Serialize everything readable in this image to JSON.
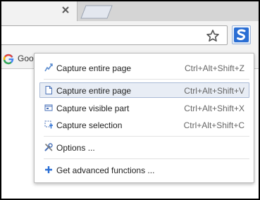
{
  "bookmarks": {
    "item_label": "Goo"
  },
  "menu": {
    "items": [
      {
        "label": "Capture entire page",
        "shortcut": "Ctrl+Alt+Shift+Z",
        "icon": "capture-scroll-icon"
      },
      {
        "label": "Capture entire page",
        "shortcut": "Ctrl+Alt+Shift+V",
        "icon": "page-icon"
      },
      {
        "label": "Capture visible part",
        "shortcut": "Ctrl+Alt+Shift+X",
        "icon": "capture-visible-icon"
      },
      {
        "label": "Capture selection",
        "shortcut": "Ctrl+Alt+Shift+C",
        "icon": "selection-icon"
      },
      {
        "label": "Options ...",
        "icon": "tools-icon"
      },
      {
        "label": "Get advanced functions ...",
        "icon": "plus-icon"
      }
    ],
    "highlighted_index": 1
  },
  "colors": {
    "accent": "#2a6ed4",
    "highlight_bg": "#e8edf5",
    "highlight_border": "#a9bad6"
  }
}
